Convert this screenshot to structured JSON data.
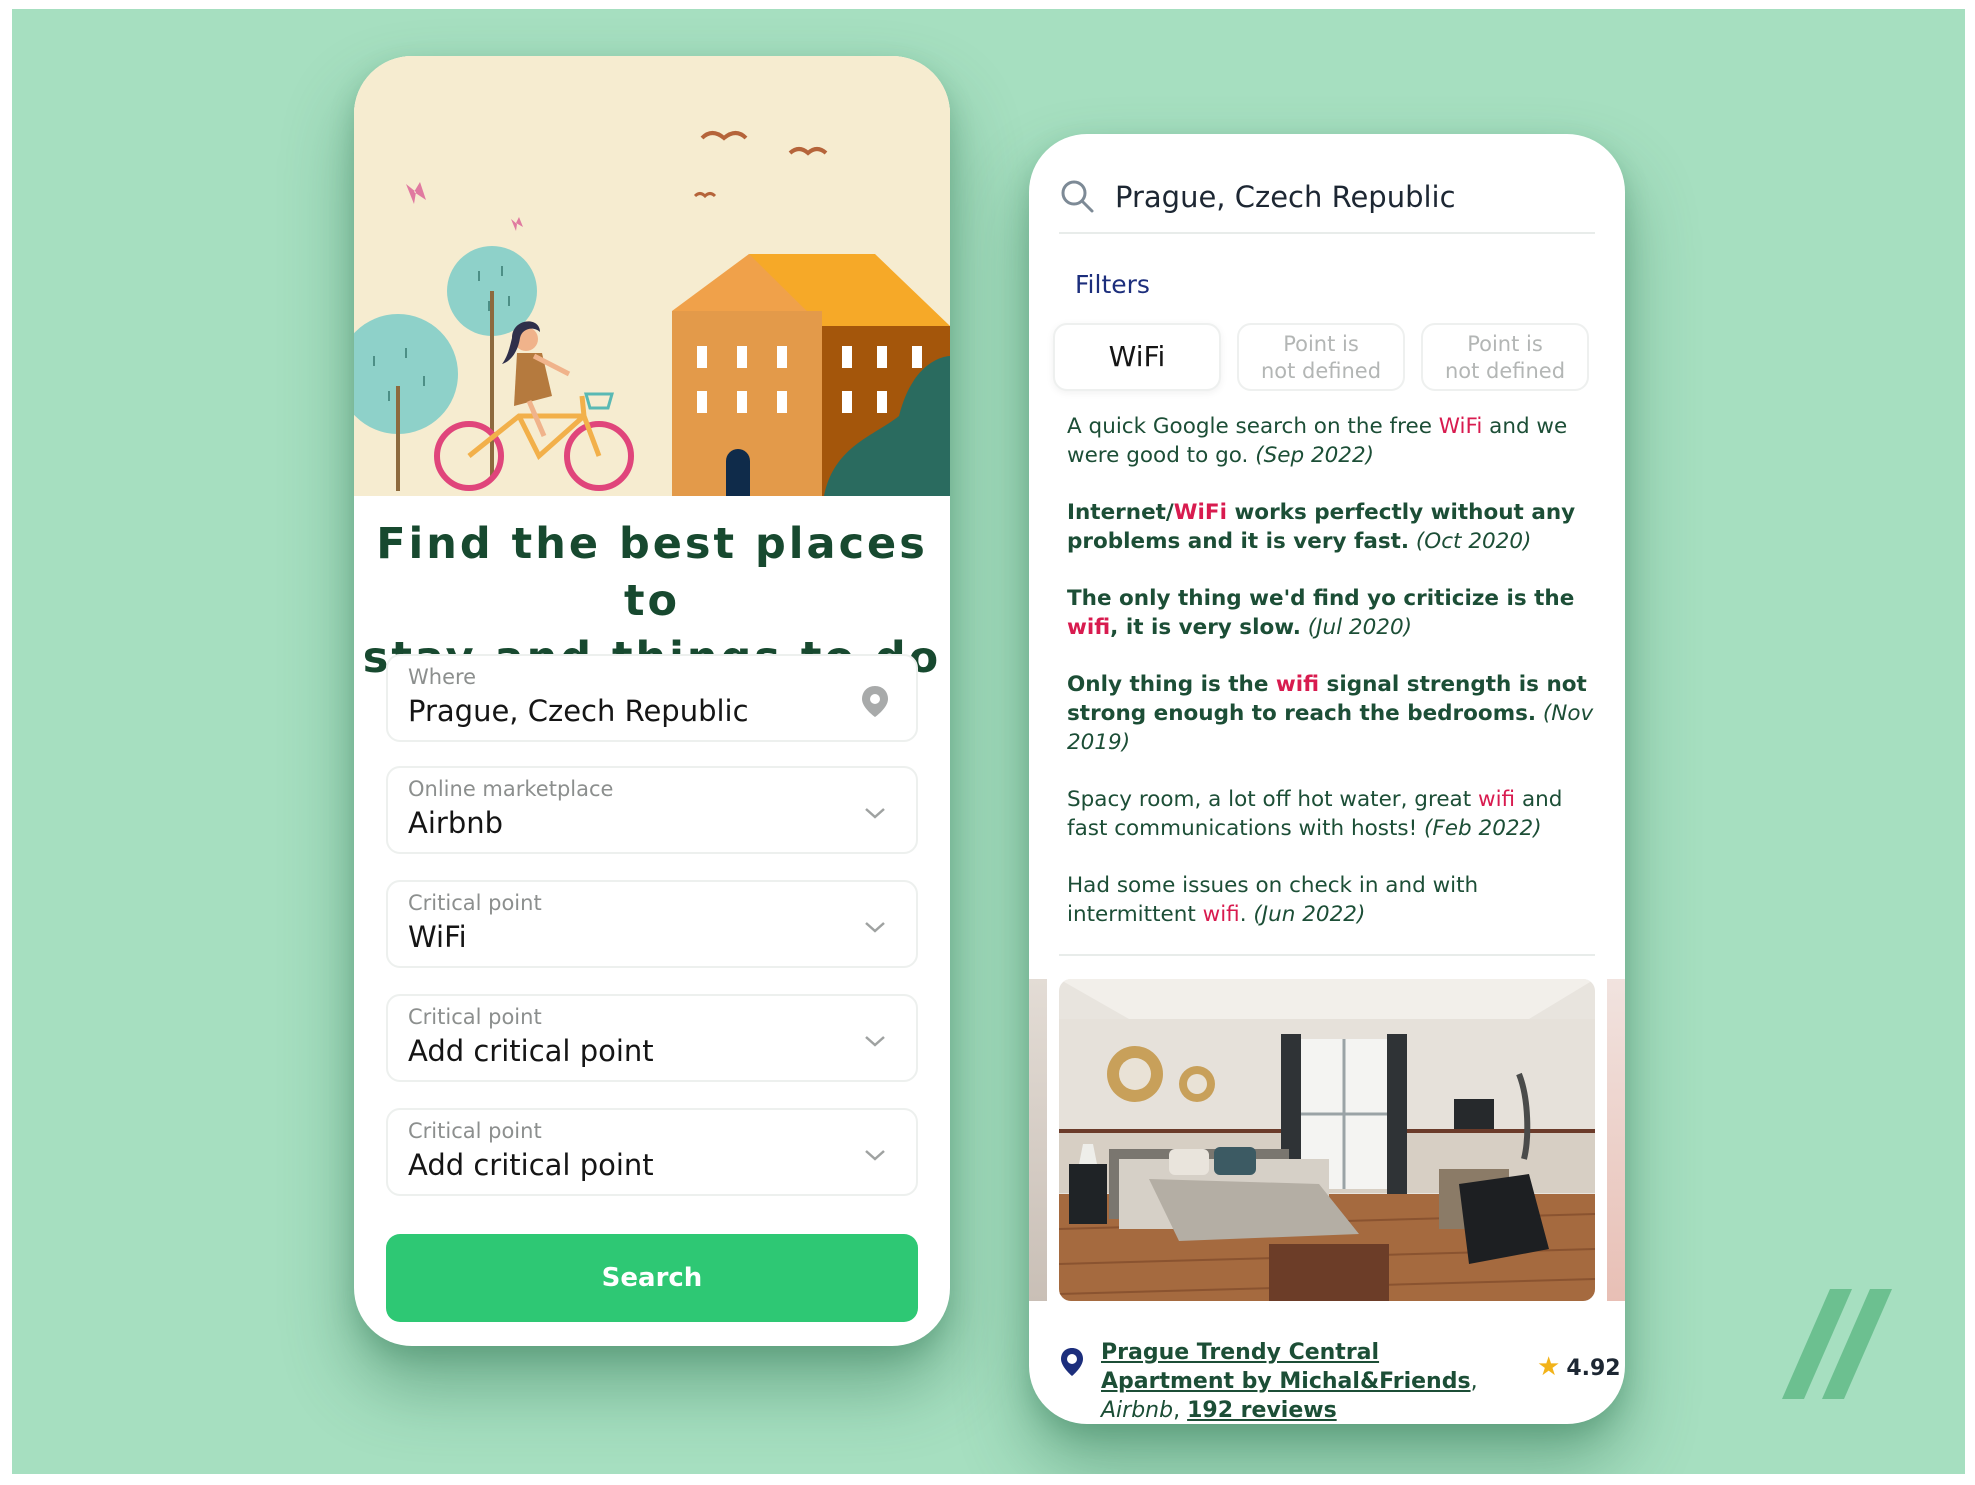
{
  "colors": {
    "background": "#a6dfc0",
    "brand_green": "#2ec874",
    "headline": "#17492f",
    "review_text": "#1c4e36",
    "highlight": "#d81b4f",
    "filters_title": "#1c2e7c",
    "star": "#f2b31a"
  },
  "left_screen": {
    "headline_line1": "Find the best places to",
    "headline_line2": "stay and things to do",
    "fields": [
      {
        "label": "Where",
        "value": "Prague, Czech Republic",
        "icon": "location-pin-icon"
      },
      {
        "label": "Online marketplace",
        "value": "Airbnb",
        "icon": "chevron-down-icon"
      },
      {
        "label": "Critical point",
        "value": "WiFi",
        "icon": "chevron-down-icon"
      },
      {
        "label": "Critical point",
        "value": "Add critical point",
        "icon": "chevron-down-icon"
      },
      {
        "label": "Critical point",
        "value": "Add critical point",
        "icon": "chevron-down-icon"
      }
    ],
    "search_button": "Search"
  },
  "right_screen": {
    "search_value": "Prague, Czech Republic",
    "filters_title": "Filters",
    "chips": [
      {
        "line1": "WiFi",
        "line2": ""
      },
      {
        "line1": "Point is",
        "line2": "not defined"
      },
      {
        "line1": "Point is",
        "line2": "not defined"
      }
    ],
    "reviews": [
      {
        "pre": "A quick Google search on the free ",
        "hl": "WiFi",
        "post": " and we were good to go.",
        "date": "(Sep 2022)"
      },
      {
        "pre": "Internet/",
        "hl": "WiFi",
        "post": " works perfectly without any problems and it is very fast.",
        "date": "(Oct 2020)"
      },
      {
        "pre": "The only thing we'd find yo criticize is the ",
        "hl": "wifi",
        "post": ", it is very slow.",
        "date": "(Jul 2020)"
      },
      {
        "pre": "Only thing is the ",
        "hl": "wifi",
        "post": " signal strength is not strong enough to reach the bedrooms.",
        "date": "(Nov 2019)"
      },
      {
        "pre": "Spacy room, a lot off hot water, great ",
        "hl": "wifi",
        "post": " and fast communications with hosts!",
        "date": "(Feb 2022)"
      },
      {
        "pre": "Had some issues on check in and with intermittent ",
        "hl": "wifi",
        "post": ".",
        "date": "(Jun 2022)"
      }
    ],
    "listing": {
      "name": "Prague Trendy Central Apartment by Michal&Friends",
      "marketplace": "Airbnb",
      "reviews_link": "192 reviews",
      "rating": "4.92"
    }
  }
}
